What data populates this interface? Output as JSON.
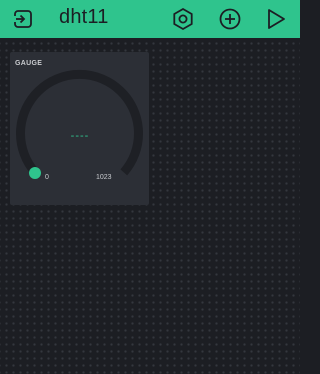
{
  "header": {
    "title": "dht11",
    "icons": [
      "back-icon",
      "device-settings-icon",
      "add-widget-icon",
      "play-icon"
    ]
  },
  "widget": {
    "label": "GAUGE",
    "value_display": "----",
    "min": "0",
    "max": "1023",
    "fill_fraction": 0
  },
  "colors": {
    "accent": "#2fc48d",
    "background": "#1c1e23",
    "widget_bg": "#2c2f36",
    "track": "#1e2025"
  }
}
